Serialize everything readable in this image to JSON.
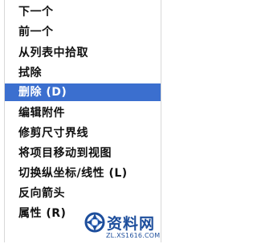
{
  "context_menu": {
    "items": [
      {
        "label": "下一个"
      },
      {
        "label": "前一个"
      },
      {
        "label": "从列表中拾取"
      },
      {
        "label": "拭除"
      },
      {
        "label": "删除 (D)",
        "selected": true
      },
      {
        "label": "编辑附件"
      },
      {
        "label": "修剪尺寸界线"
      },
      {
        "label": "将项目移动到视图"
      },
      {
        "label": "切换纵坐标/线性 (L)"
      },
      {
        "label": "反向箭头"
      },
      {
        "label": "属性 (R)"
      }
    ]
  },
  "watermark": {
    "title": "资料网",
    "url": "ZL.XS1616.COM",
    "color": "#1d4e9c"
  },
  "colors": {
    "selection": "#3b6fcf",
    "text": "#111111"
  }
}
